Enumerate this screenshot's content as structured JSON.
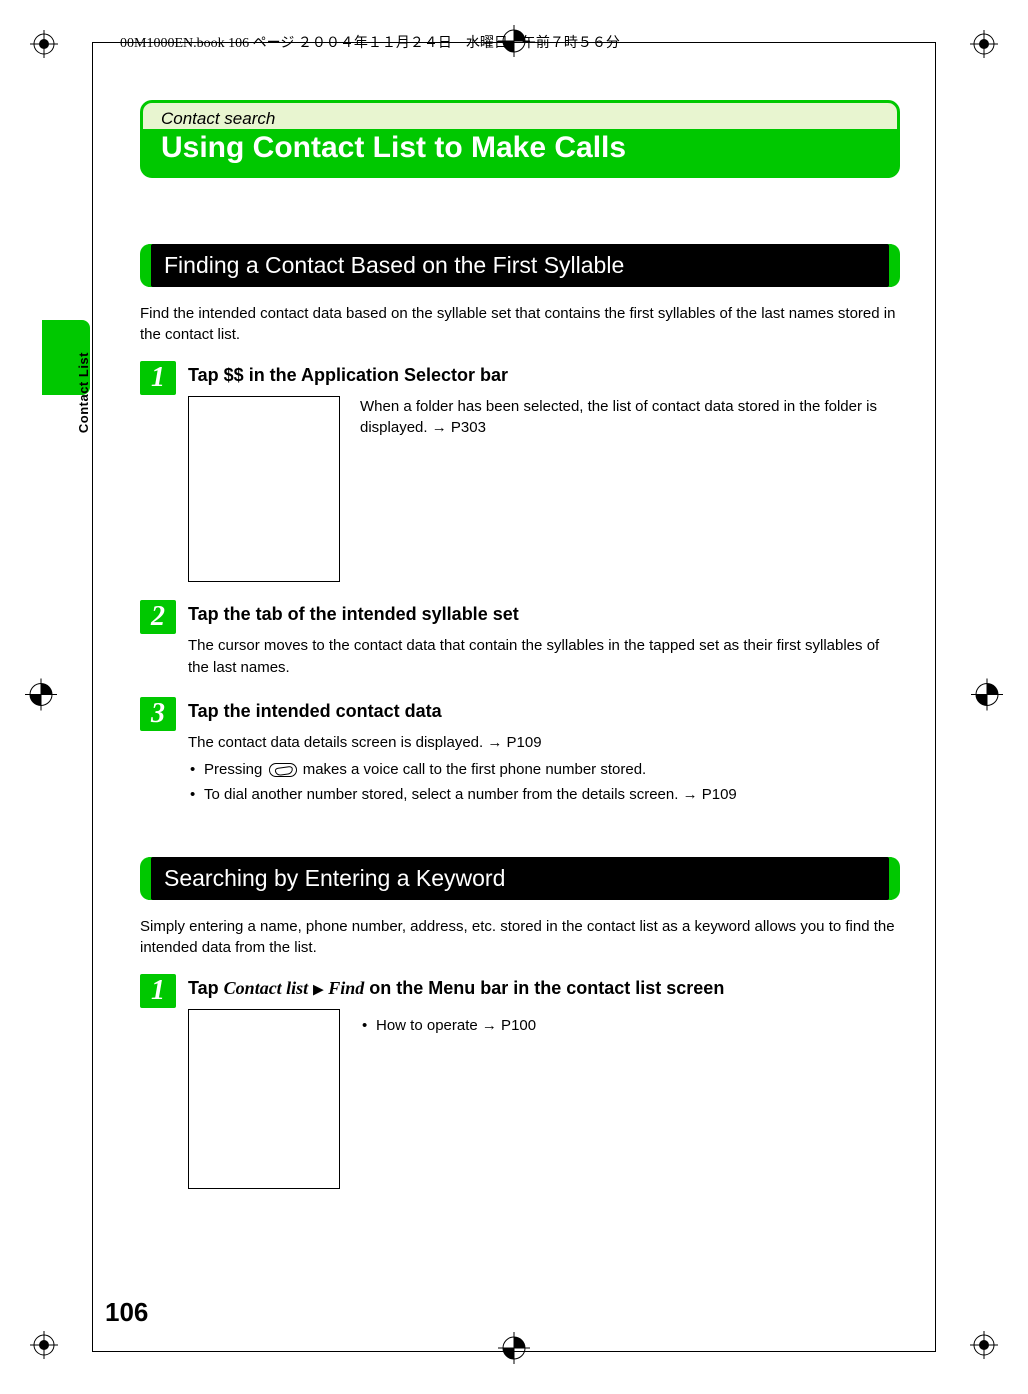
{
  "header": "00M1000EN.book  106 ページ  ２００４年１１月２４日　水曜日　午前７時５６分",
  "side_label": "Contact List",
  "title_box": {
    "category": "Contact search",
    "main": "Using Contact List to Make Calls"
  },
  "section1": {
    "heading": "Finding a Contact Based on the First Syllable",
    "intro": "Find the intended contact data based on the syllable set that contains the first syllables of the last names stored in the contact list.",
    "step1": {
      "num": "1",
      "title": "Tap $$ in the Application Selector bar",
      "note_a": "When a folder has been selected, the list of contact data stored in the folder is displayed. → P303"
    },
    "step2": {
      "num": "2",
      "title": "Tap the tab of the intended syllable set",
      "body": "The cursor moves to the contact data that contain the syllables in the tapped set as their first syllables of the last names."
    },
    "step3": {
      "num": "3",
      "title": "Tap the intended contact data",
      "body": "The contact data details screen is displayed. → P109",
      "bullet1_a": "Pressing ",
      "bullet1_b": " makes a voice call to the first phone number stored.",
      "bullet2": "To dial another number stored, select a number from the details screen. → P109"
    }
  },
  "section2": {
    "heading": "Searching by Entering a Keyword",
    "intro": "Simply entering a name, phone number, address, etc. stored in the contact list as a keyword allows you to find the intended data from the list.",
    "step1": {
      "num": "1",
      "title_a": "Tap ",
      "title_menu1": "Contact list",
      "title_menu2": "Find",
      "title_b": " on the Menu bar in the contact list screen",
      "bullet1": "How to operate → P100"
    }
  },
  "page_number": "106"
}
